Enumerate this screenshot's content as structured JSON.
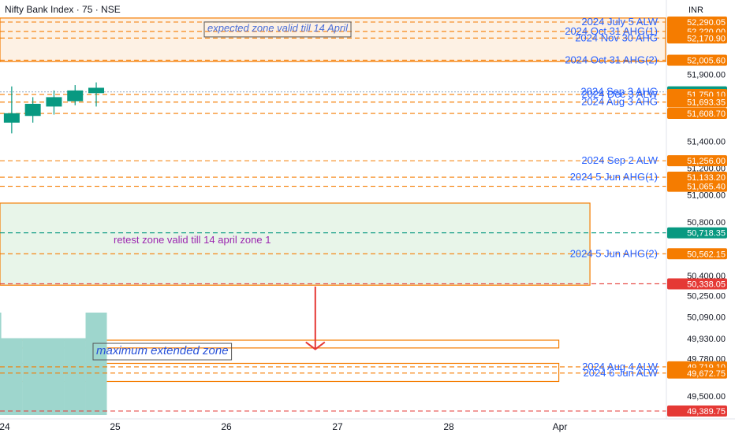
{
  "header": {
    "symbol": "Nifty Bank Index · 75 · NSE",
    "currency": "INR"
  },
  "chart_data": {
    "type": "candlestick",
    "title": "Nifty Bank Index · 75 · NSE",
    "ylim": [
      49300,
      52320
    ],
    "axis_ticks": [
      "52,290.05",
      "52,220.00",
      "52,170.90",
      "52,005.60",
      "51,900.00",
      "51,769.60",
      "51,750.10",
      "51,693.95",
      "51,693.35",
      "51,608.70",
      "51,400.00",
      "51,256.00",
      "51,200.00",
      "51,133.20",
      "51,065.40",
      "51,000.00",
      "50,800.00",
      "50,718.35",
      "50,562.15",
      "50,400.00",
      "50,338.05",
      "50,250.00",
      "50,090.00",
      "49,930.00",
      "49,780.00",
      "49,719.10",
      "49,672.75",
      "49,500.00",
      "49,389.75"
    ],
    "x_ticks": [
      {
        "label": "24",
        "x": 0
      },
      {
        "label": "25",
        "x": 1
      },
      {
        "label": "26",
        "x": 2
      },
      {
        "label": "27",
        "x": 3
      },
      {
        "label": "28",
        "x": 4
      },
      {
        "label": "Apr",
        "x": 5
      }
    ],
    "candles": [
      {
        "t": -0.12,
        "open": 50900,
        "high": 51530,
        "low": 50790,
        "close": 51480
      },
      {
        "t": 0.07,
        "open": 51540,
        "high": 51810,
        "low": 51460,
        "close": 51610
      },
      {
        "t": 0.26,
        "open": 51590,
        "high": 51730,
        "low": 51540,
        "close": 51680
      },
      {
        "t": 0.45,
        "open": 51660,
        "high": 51780,
        "low": 51600,
        "close": 51730
      },
      {
        "t": 0.64,
        "open": 51700,
        "high": 51820,
        "low": 51670,
        "close": 51780
      },
      {
        "t": 0.83,
        "open": 51800,
        "high": 51840,
        "low": 51660,
        "close": 51760
      }
    ],
    "volume": [
      {
        "t": -0.12,
        "value": 1.0
      },
      {
        "t": 0.07,
        "value": 0.75
      },
      {
        "t": 0.26,
        "value": 0.75
      },
      {
        "t": 0.45,
        "value": 0.75
      },
      {
        "t": 0.64,
        "value": 0.75
      },
      {
        "t": 0.83,
        "value": 1.0
      }
    ],
    "levels": [
      {
        "label": "2024 July 5 ALW",
        "value": 52290.05,
        "tag": "52,290.05",
        "kind": "orange"
      },
      {
        "label": "2024 Oct 31 AHG(1)",
        "value": 52220.0,
        "tag": "52,220.00",
        "kind": "orange"
      },
      {
        "label": "2024 Nov 30 AHG",
        "value": 52170.9,
        "tag": "52,170.90",
        "kind": "orange"
      },
      {
        "label": "2024 Oct 31 AHG(2)",
        "value": 52005.6,
        "tag": "52,005.60",
        "kind": "orange"
      },
      {
        "label": "2024 Sep 3 AHG",
        "value": 51769.6,
        "tag": "51,769.60",
        "kind": "price"
      },
      {
        "label": "2024 Dec 3 ALW",
        "value": 51750.1,
        "tag": "51,750.10",
        "kind": "orange"
      },
      {
        "label": "2024 Aug 3 AHG",
        "value": 51693.95,
        "tag": "51,693.95",
        "kind": "orange"
      },
      {
        "label": "",
        "value": 51693.35,
        "tag": "51,693.35",
        "kind": "orange"
      },
      {
        "label": "",
        "value": 51608.7,
        "tag": "51,608.70",
        "kind": "orange"
      },
      {
        "label": "2024 Sep 2 ALW",
        "value": 51256.0,
        "tag": "51,256.00",
        "kind": "orange"
      },
      {
        "label": "2024 5 Jun AHG(1)",
        "value": 51133.2,
        "tag": "51,133.20",
        "kind": "orange"
      },
      {
        "label": "",
        "value": 51065.4,
        "tag": "51,065.40",
        "kind": "orange"
      },
      {
        "label": "",
        "value": 50718.35,
        "tag": "50,718.35",
        "kind": "green"
      },
      {
        "label": "2024 5 Jun AHG(2)",
        "value": 50562.15,
        "tag": "50,562.15",
        "kind": "orange"
      },
      {
        "label": "",
        "value": 50338.05,
        "tag": "50,338.05",
        "kind": "red"
      },
      {
        "label": "2024 Aug 4 ALW",
        "value": 49719.1,
        "tag": "49,719.10",
        "kind": "orange"
      },
      {
        "label": "2024 6 Jun ALW",
        "value": 49672.75,
        "tag": "49,672.75",
        "kind": "orange"
      },
      {
        "label": "",
        "value": 49389.75,
        "tag": "49,389.75",
        "kind": "red"
      }
    ],
    "zones": [
      {
        "label": "expected zone valid till 14 April",
        "top": 52320,
        "bottom": 51995,
        "fill": "#fdf1e4",
        "stroke": "#f57c00",
        "labelColor": "#4a6ed8",
        "italic": true,
        "boxed": true,
        "x1": -0.2,
        "x2": 5.95
      },
      {
        "label": "retest zone valid till 14 april zone 1",
        "top": 50940,
        "bottom": 50328,
        "fill": "#e8f5e9",
        "stroke": "#f57c00",
        "labelColor": "#9c27b0",
        "italic": false,
        "boxed": false,
        "x1": -0.2,
        "x2": 5.27
      },
      {
        "label": "maximum extended zone",
        "top": 49918,
        "bottom": 49860,
        "fill": "#ffffff",
        "stroke": "#f57c00",
        "labelColor": "#2952d9",
        "italic": true,
        "boxed": true,
        "x1": -0.2,
        "x2": 4.99
      },
      {
        "label": "",
        "top": 49745,
        "bottom": 49610,
        "fill": "#ffffff",
        "stroke": "#f57c00",
        "labelColor": "",
        "italic": false,
        "boxed": false,
        "x1": -0.2,
        "x2": 4.99
      }
    ],
    "arrow": {
      "t": 2.8,
      "from": 50318,
      "to": 49850
    }
  },
  "colors": {
    "up": "#089981",
    "down": "#089981",
    "orange": "#f57c00",
    "green": "#089981",
    "red": "#e53935",
    "price": "#089981",
    "volume": "#9ed6cd",
    "labelBlue": "#2962ff"
  }
}
